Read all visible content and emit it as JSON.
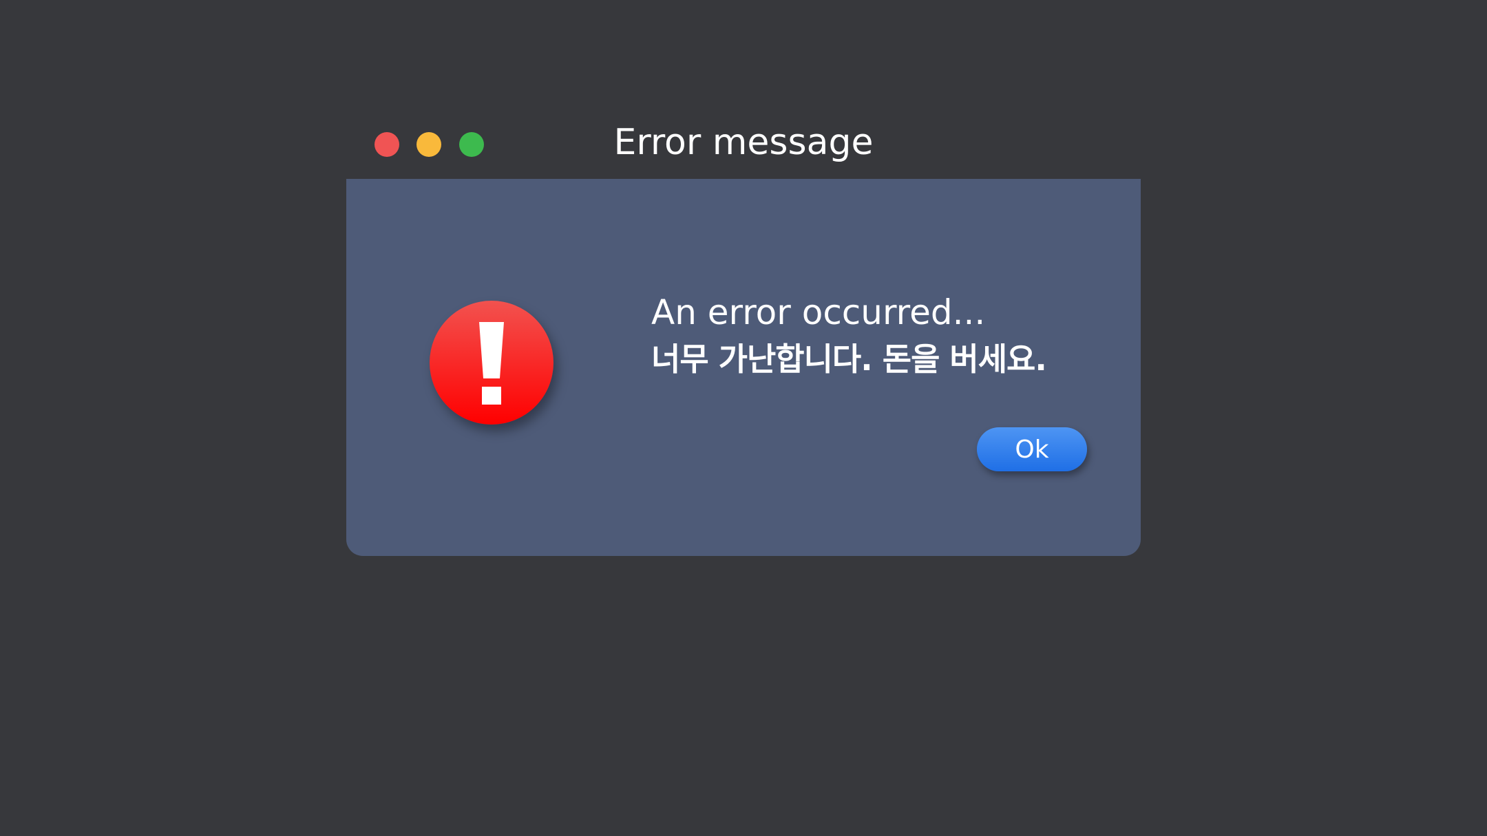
{
  "window": {
    "title": "Error message"
  },
  "titlebar": {
    "buttons": [
      {
        "name": "close",
        "color": "#f05454"
      },
      {
        "name": "minimize",
        "color": "#f9b93b"
      },
      {
        "name": "zoom",
        "color": "#3dba4e"
      }
    ]
  },
  "dialog": {
    "icon": "exclamation-icon",
    "message_line1": "An error occurred...",
    "message_line2": "너무 가난합니다. 돈을 버세요.",
    "ok_label": "Ok"
  },
  "colors": {
    "background": "#37383c",
    "dialog_body": "#4e5b78",
    "icon_red_top": "#f2524f",
    "icon_red_bottom": "#ff0000",
    "button_blue_top": "#4e95f3",
    "button_blue_bottom": "#1f6fe6",
    "text": "#ffffff"
  }
}
